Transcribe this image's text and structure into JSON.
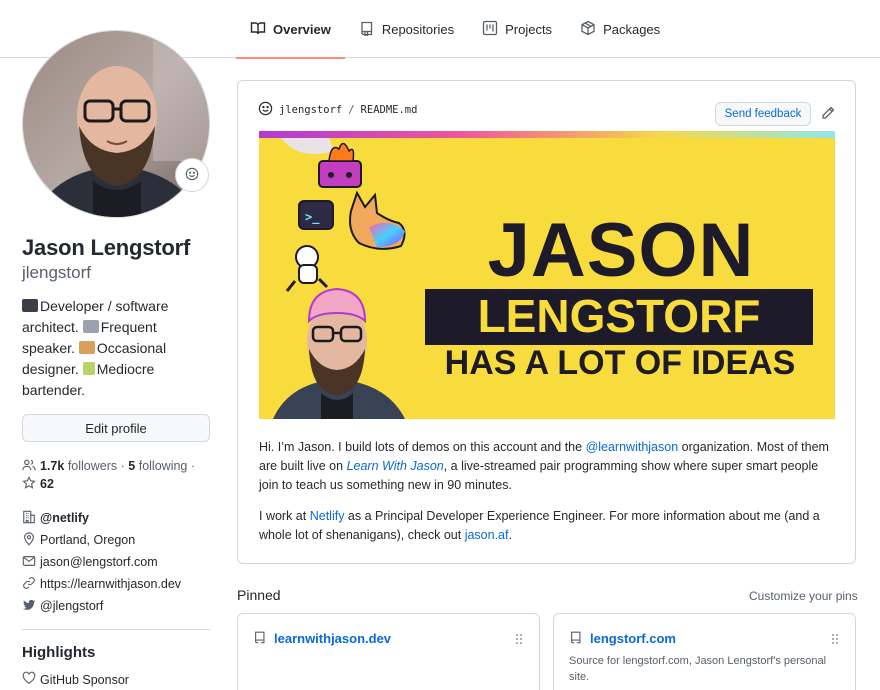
{
  "nav": {
    "tabs": [
      {
        "label": "Overview",
        "icon": "book-icon"
      },
      {
        "label": "Repositories",
        "icon": "repo-icon"
      },
      {
        "label": "Projects",
        "icon": "project-icon"
      },
      {
        "label": "Packages",
        "icon": "package-icon"
      }
    ]
  },
  "profile": {
    "fullname": "Jason Lengstorf",
    "username": "jlengstorf",
    "bio": [
      {
        "emoji": "laptop",
        "text": "Developer / software architect."
      },
      {
        "emoji": "loudspeaker",
        "text": "Frequent speaker."
      },
      {
        "emoji": "palette",
        "text": "Occasional designer."
      },
      {
        "emoji": "cocktail",
        "text": "Mediocre bartender."
      }
    ],
    "edit_label": "Edit profile",
    "followers_count": "1.7k",
    "followers_label": "followers",
    "following_count": "5",
    "following_label": "following",
    "bullet": "·",
    "stars_count": "62",
    "details": {
      "org": "@netlify",
      "location": "Portland, Oregon",
      "email": "jason@lengstorf.com",
      "website": "https://learnwithjason.dev",
      "twitter": "@jlengstorf"
    },
    "highlights_title": "Highlights",
    "highlights": [
      "GitHub Sponsor"
    ]
  },
  "readme": {
    "owner": "jlengstorf",
    "slash": "/",
    "file": "README.md",
    "feedback_label": "Send feedback",
    "banner": {
      "line1": "JASON",
      "line2": "LENGSTORF",
      "line3": "HAS A LOT OF IDEAS",
      "terminal_prompt": ">_"
    },
    "p1": {
      "t1": "Hi. I’m Jason. I build lots of demos on this account and the ",
      "link1": "@learnwithjason",
      "t2": " organization. Most of them are built live on ",
      "link2": "Learn With Jason",
      "t3": ", a live-streamed pair programming show where super smart people join to teach us something new in 90 minutes."
    },
    "p2": {
      "t1": "I work at ",
      "link1": "Netlify",
      "t2": " as a Principal Developer Experience Engineer. For more information about me (and a whole lot of shenanigans), check out ",
      "link2": "jason.af",
      "t3": "."
    }
  },
  "pinned": {
    "title": "Pinned",
    "customize_label": "Customize your pins",
    "items": [
      {
        "name": "learnwithjason.dev",
        "description": ""
      },
      {
        "name": "lengstorf.com",
        "description": "Source for lengstorf.com, Jason Lengstorf's personal site."
      }
    ]
  },
  "colors": {
    "accent_underline": "#fd8c73",
    "link": "#0969da",
    "banner_yellow": "#f8dc3d",
    "banner_dark": "#1d1a29"
  }
}
